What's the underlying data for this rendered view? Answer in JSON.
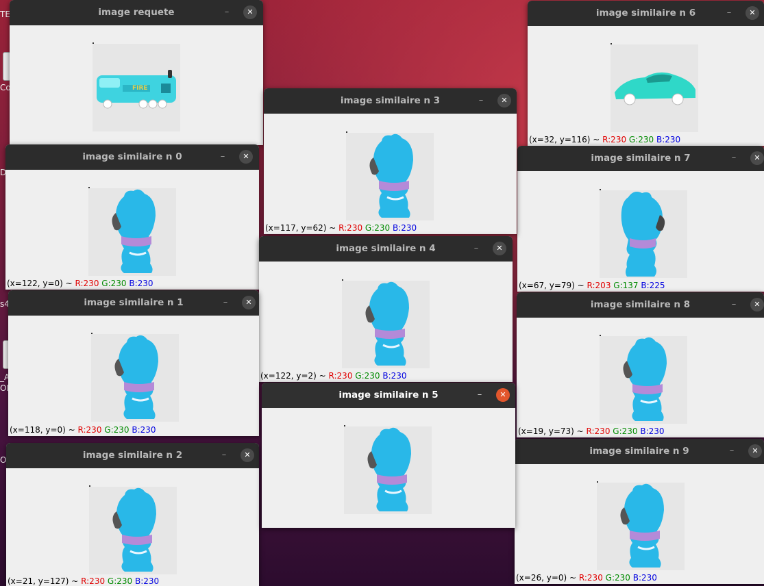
{
  "desktop": {
    "edge_fragments": [
      "TE",
      "Co",
      "D",
      "s4",
      "_A",
      "OI",
      "O"
    ]
  },
  "windows": {
    "requete": {
      "title": "image requete",
      "image": "fire-truck-toy"
    },
    "s0": {
      "title": "image similaire n 0",
      "image": "blue-bear-toy",
      "status": {
        "coords": "(x=122, y=0) ~ ",
        "r": "R:230",
        "g": "G:230",
        "b": "B:230"
      }
    },
    "s1": {
      "title": "image similaire n 1",
      "image": "blue-bear-toy",
      "status": {
        "coords": "(x=118, y=0) ~ ",
        "r": "R:230",
        "g": "G:230",
        "b": "B:230"
      }
    },
    "s2": {
      "title": "image similaire n 2",
      "image": "blue-bear-toy",
      "status": {
        "coords": "(x=21, y=127) ~ ",
        "r": "R:230",
        "g": "G:230",
        "b": "B:230"
      }
    },
    "s3": {
      "title": "image similaire n 3",
      "image": "blue-bear-toy",
      "status": {
        "coords": "(x=117, y=62) ~ ",
        "r": "R:230",
        "g": "G:230",
        "b": "B:230"
      }
    },
    "s4": {
      "title": "image similaire n 4",
      "image": "blue-bear-toy",
      "status": {
        "coords": "(x=122, y=2) ~ ",
        "r": "R:230",
        "g": "G:230",
        "b": "B:230"
      }
    },
    "s5": {
      "title": "image similaire n 5",
      "image": "blue-bear-toy"
    },
    "s6": {
      "title": "image similaire n 6",
      "image": "teal-sports-car-toy",
      "status": {
        "coords": "(x=32, y=116) ~ ",
        "r": "R:230",
        "g": "G:230",
        "b": "B:230"
      }
    },
    "s7": {
      "title": "image similaire n 7",
      "image": "blue-bear-toy-facing-right",
      "status": {
        "coords": "(x=67, y=79) ~ ",
        "r": "R:203",
        "g": "G:137",
        "b": "B:225"
      }
    },
    "s8": {
      "title": "image similaire n 8",
      "image": "blue-bear-toy",
      "status": {
        "coords": "(x=19, y=73) ~ ",
        "r": "R:230",
        "g": "G:230",
        "b": "B:230"
      }
    },
    "s9": {
      "title": "image similaire n 9",
      "image": "blue-bear-toy",
      "status": {
        "coords": "(x=26, y=0) ~ ",
        "r": "R:230",
        "g": "G:230",
        "b": "B:230"
      }
    }
  },
  "controls": {
    "minimize_glyph": "–",
    "close_glyph": "✕"
  },
  "colors": {
    "titlebar": "#2c2c2c",
    "active_close": "#e2562c",
    "r_value": "#e00000",
    "g_value": "#008a00",
    "b_value": "#0000e0"
  }
}
